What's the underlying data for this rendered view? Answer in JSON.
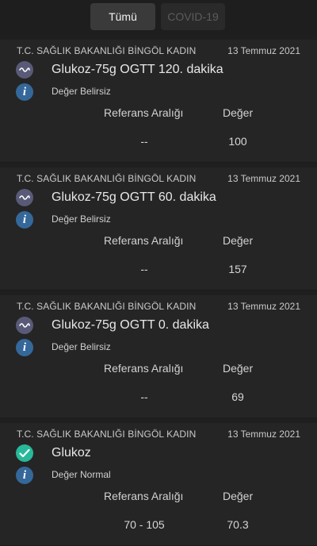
{
  "filters": [
    {
      "label": "Tümü",
      "active": true
    },
    {
      "label": "COVID-19",
      "active": false
    }
  ],
  "columns": {
    "reference": "Referans Aralığı",
    "value": "Değer"
  },
  "results": [
    {
      "institution": "T.C. SAĞLIK BAKANLIĞI BİNGÖL KADIN",
      "date": "13 Temmuz 2021",
      "test": "Glukoz-75g OGTT 120. dakika",
      "status_icon": "wave-icon",
      "evaluation": "Değer Belirsiz",
      "reference": "--",
      "value": "100"
    },
    {
      "institution": "T.C. SAĞLIK BAKANLIĞI BİNGÖL KADIN",
      "date": "13 Temmuz 2021",
      "test": "Glukoz-75g OGTT 60. dakika",
      "status_icon": "wave-icon",
      "evaluation": "Değer Belirsiz",
      "reference": "--",
      "value": "157"
    },
    {
      "institution": "T.C. SAĞLIK BAKANLIĞI BİNGÖL KADIN",
      "date": "13 Temmuz 2021",
      "test": "Glukoz-75g OGTT 0. dakika",
      "status_icon": "wave-icon",
      "evaluation": "Değer Belirsiz",
      "reference": "--",
      "value": "69"
    },
    {
      "institution": "T.C. SAĞLIK BAKANLIĞI BİNGÖL KADIN",
      "date": "13 Temmuz 2021",
      "test": "Glukoz",
      "status_icon": "check-icon",
      "evaluation": "Değer Normal",
      "reference": "70 - 105",
      "value": "70.3"
    }
  ],
  "colors": {
    "background": "#232323",
    "uncertain_icon": "#595a77",
    "normal_icon": "#27b99a",
    "info_icon": "#35689a"
  }
}
